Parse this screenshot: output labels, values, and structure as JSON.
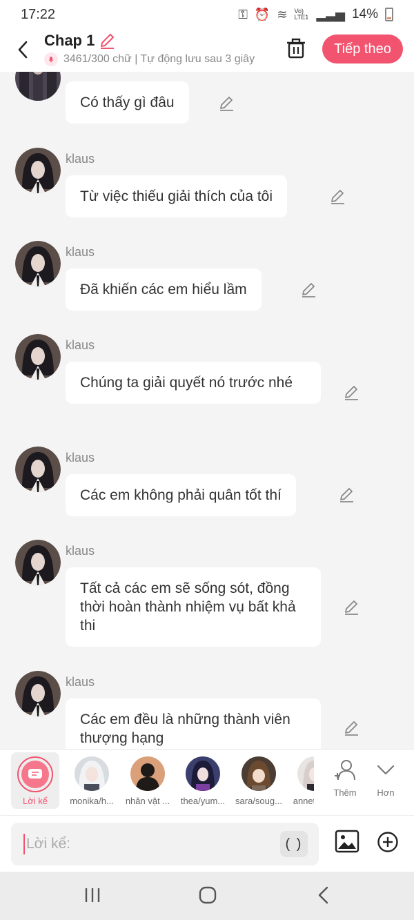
{
  "status_bar": {
    "time": "17:22",
    "network": "Vo) LTE1",
    "battery": "14%"
  },
  "header": {
    "title": "Chap 1",
    "subtitle": "3461/300 chữ | Tự động lưu sau 3 giây",
    "next_label": "Tiếp theo"
  },
  "messages": [
    {
      "name": "",
      "text": "Có thấy gì đâu"
    },
    {
      "name": "klaus",
      "text": "Từ việc thiếu giải thích của tôi"
    },
    {
      "name": "klaus",
      "text": "Đã khiến các em hiểu lầm"
    },
    {
      "name": "klaus",
      "text": "Chúng ta giải quyết nó trước nhé"
    },
    {
      "name": "klaus",
      "text": "Các em không phải quân tốt thí"
    },
    {
      "name": "klaus",
      "text": "Tất cả các em sẽ sống sót, đồng thời hoàn thành nhiệm vụ bất khả thi"
    },
    {
      "name": "klaus",
      "text": "Các em đều là những thành viên thượng hạng"
    }
  ],
  "characters": {
    "narrator_label": "Lời kể",
    "items": [
      {
        "label": "monika/h..."
      },
      {
        "label": "nhân vật ..."
      },
      {
        "label": "thea/yum..."
      },
      {
        "label": "sara/soug..."
      },
      {
        "label": "annet"
      }
    ],
    "add_label": "Thêm",
    "more_label": "Hơn"
  },
  "input": {
    "placeholder": "Lời kể:",
    "paren_label": "( )"
  },
  "colors": {
    "accent": "#f2536f",
    "bubble": "#ffffff",
    "background": "#f4f4f4"
  }
}
